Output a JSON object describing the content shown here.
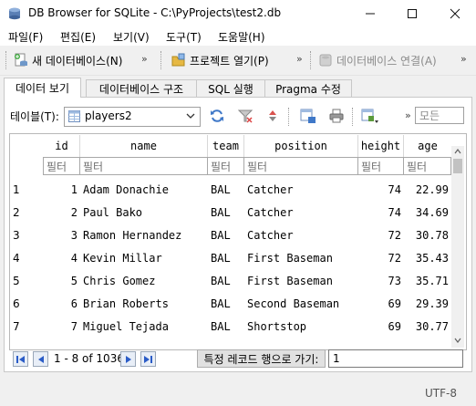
{
  "window": {
    "title": "DB Browser for SQLite - C:\\PyProjects\\test2.db"
  },
  "menu": [
    "파일(F)",
    "편집(E)",
    "보기(V)",
    "도구(T)",
    "도움말(H)"
  ],
  "toolbar": {
    "new_db": "새 데이터베이스(N)",
    "open_project": "프로젝트 열기(P)",
    "attach_db": "데이터베이스 연결(A)"
  },
  "tabs": [
    "데이터 보기",
    "데이터베이스 구조",
    "SQL 실행",
    "Pragma 수정"
  ],
  "browse": {
    "table_label": "테이블(T):",
    "table_value": "players2",
    "filter_all_placeholder": "모든"
  },
  "grid": {
    "columns": [
      "id",
      "name",
      "team",
      "position",
      "height",
      "age"
    ],
    "filter_placeholder": "필터",
    "rows": [
      {
        "rownum": "1",
        "id": "1",
        "name": "Adam Donachie",
        "team": "BAL",
        "position": "Catcher",
        "height": "74",
        "age": "22.99"
      },
      {
        "rownum": "2",
        "id": "2",
        "name": "Paul Bako",
        "team": "BAL",
        "position": "Catcher",
        "height": "74",
        "age": "34.69"
      },
      {
        "rownum": "3",
        "id": "3",
        "name": "Ramon Hernandez",
        "team": "BAL",
        "position": "Catcher",
        "height": "72",
        "age": "30.78"
      },
      {
        "rownum": "4",
        "id": "4",
        "name": "Kevin Millar",
        "team": "BAL",
        "position": "First Baseman",
        "height": "72",
        "age": "35.43"
      },
      {
        "rownum": "5",
        "id": "5",
        "name": "Chris Gomez",
        "team": "BAL",
        "position": "First Baseman",
        "height": "73",
        "age": "35.71"
      },
      {
        "rownum": "6",
        "id": "6",
        "name": "Brian Roberts",
        "team": "BAL",
        "position": "Second Baseman",
        "height": "69",
        "age": "29.39"
      },
      {
        "rownum": "7",
        "id": "7",
        "name": "Miguel Tejada",
        "team": "BAL",
        "position": "Shortstop",
        "height": "69",
        "age": "30.77"
      }
    ]
  },
  "nav": {
    "record_info": "1 - 8 of 1036",
    "goto_label": "특정 레코드 행으로 가기:",
    "goto_value": "1"
  },
  "status": {
    "encoding": "UTF-8"
  }
}
